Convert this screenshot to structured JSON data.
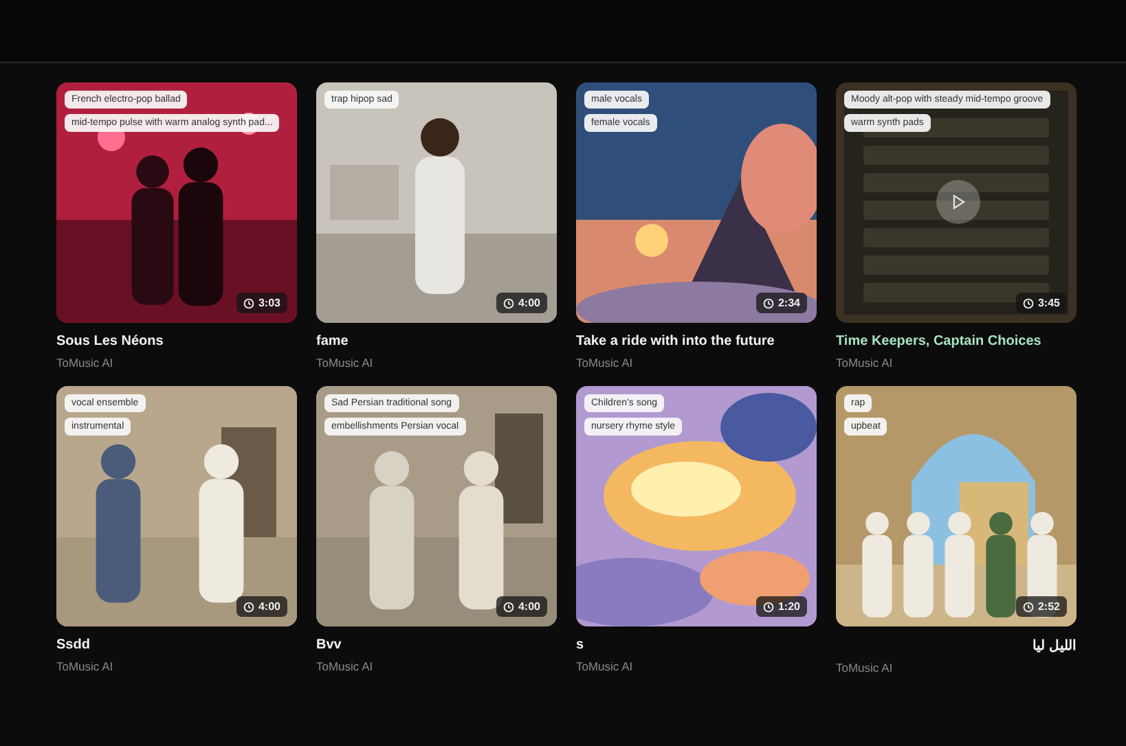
{
  "cards": [
    {
      "title": "Sous Les Néons",
      "author": "ToMusic AI",
      "duration": "3:03",
      "tags": [
        "French electro-pop ballad",
        "mid-tempo pulse with warm analog synth pad..."
      ],
      "hovered": false
    },
    {
      "title": "fame",
      "author": "ToMusic AI",
      "duration": "4:00",
      "tags": [
        "trap hipop sad"
      ],
      "hovered": false
    },
    {
      "title": "Take a ride with into the future",
      "author": "ToMusic AI",
      "duration": "2:34",
      "tags": [
        "male vocals",
        "female vocals"
      ],
      "hovered": false
    },
    {
      "title": "Time Keepers, Captain Choices",
      "author": "ToMusic AI",
      "duration": "3:45",
      "tags": [
        "Moody alt-pop with steady mid-tempo groove",
        "warm synth pads"
      ],
      "hovered": true
    },
    {
      "title": "Ssdd",
      "author": "ToMusic AI",
      "duration": "4:00",
      "tags": [
        "vocal ensemble",
        "instrumental"
      ],
      "hovered": false
    },
    {
      "title": "Bvv",
      "author": "ToMusic AI",
      "duration": "4:00",
      "tags": [
        "Sad Persian traditional song",
        "embellishments Persian vocal"
      ],
      "hovered": false
    },
    {
      "title": "s",
      "author": "ToMusic AI",
      "duration": "1:20",
      "tags": [
        "Children's song",
        "nursery rhyme style"
      ],
      "hovered": false
    },
    {
      "title": "الليل ليا",
      "author": "ToMusic AI",
      "duration": "2:52",
      "tags": [
        "rap",
        "upbeat"
      ],
      "hovered": false
    }
  ]
}
